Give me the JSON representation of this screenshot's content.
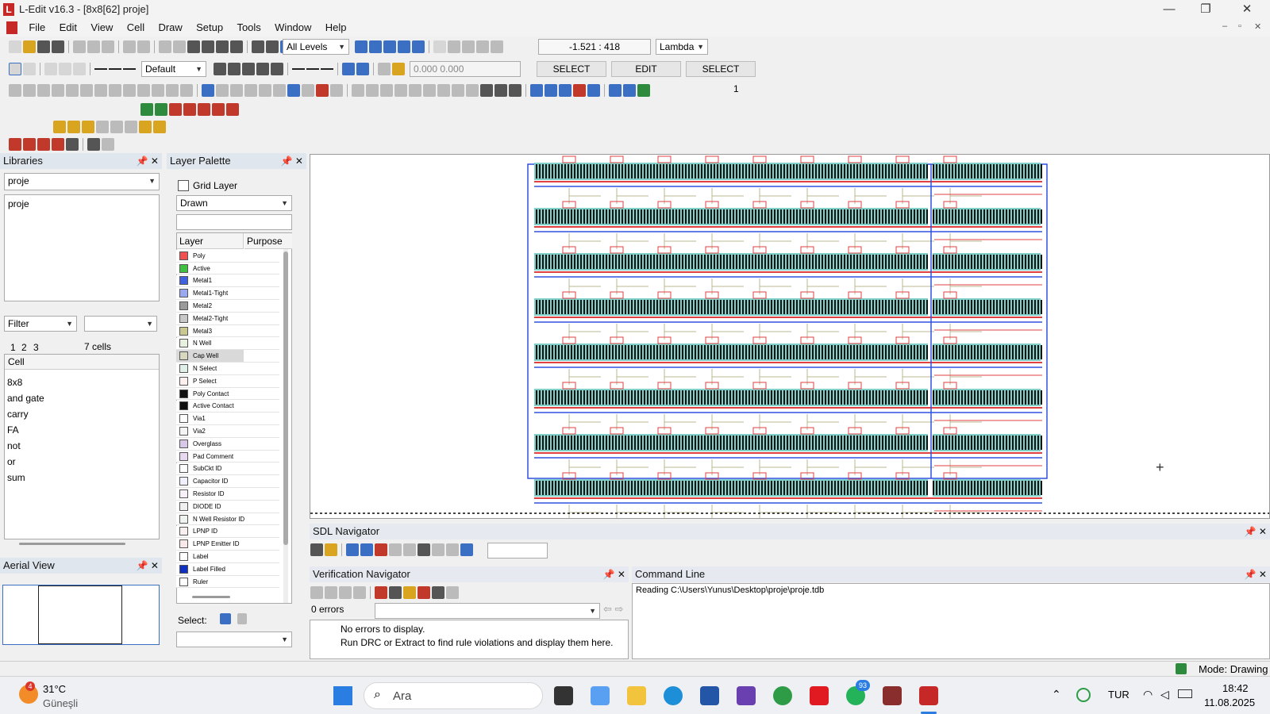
{
  "window": {
    "title": "L-Edit v16.3 - [8x8[62]    proje]",
    "logo": "L",
    "controls": [
      "—",
      "❐",
      "✕"
    ],
    "doc_controls": [
      "–",
      "▫",
      "✕"
    ]
  },
  "menu": [
    "File",
    "Edit",
    "View",
    "Cell",
    "Draw",
    "Setup",
    "Tools",
    "Window",
    "Help"
  ],
  "toolbar": {
    "view_level": "All Levels",
    "coords": "-1.521 : 418",
    "units": "Lambda",
    "style": "Default",
    "coord_input": "0.000 0.000",
    "mode_buttons": [
      "SELECT",
      "EDIT",
      "SELECT"
    ],
    "count_value": "1"
  },
  "libraries": {
    "title": "Libraries",
    "selected": "proje",
    "list": [
      "proje"
    ],
    "filter_label": "Filter",
    "tabs": [
      "1",
      "2",
      "3"
    ],
    "count": "7 cells",
    "cell_header": "Cell",
    "cells": [
      "8x8",
      "and gate",
      "carry",
      "FA",
      "not",
      "or",
      "sum"
    ]
  },
  "layer_palette": {
    "title": "Layer Palette",
    "grid_layer": "Grid Layer",
    "view_mode": "Drawn",
    "col_layer": "Layer",
    "col_purpose": "Purpose",
    "select_label": "Select:",
    "layers": [
      {
        "name": "Poly",
        "color": "#f05050"
      },
      {
        "name": "Active",
        "color": "#40c040"
      },
      {
        "name": "Metal1",
        "color": "#4060e0"
      },
      {
        "name": "Metal1-Tight",
        "color": "#9aa8f0"
      },
      {
        "name": "Metal2",
        "color": "#9a9a9a"
      },
      {
        "name": "Metal2-Tight",
        "color": "#c8c8c8"
      },
      {
        "name": "Metal3",
        "color": "#c8c890"
      },
      {
        "name": "N Well",
        "color": "#e8f0e0"
      },
      {
        "name": "Cap Well",
        "color": "#d8d8c0"
      },
      {
        "name": "N Select",
        "color": "#e0f0e8"
      },
      {
        "name": "P Select",
        "color": "#fff0f0"
      },
      {
        "name": "Poly Contact",
        "color": "#111111"
      },
      {
        "name": "Active Contact",
        "color": "#111111"
      },
      {
        "name": "Via1",
        "color": "#ffffff"
      },
      {
        "name": "Via2",
        "color": "#f4f4f4"
      },
      {
        "name": "Overglass",
        "color": "#d8c8e8"
      },
      {
        "name": "Pad Comment",
        "color": "#e8d8f0"
      },
      {
        "name": "SubCkt ID",
        "color": "#ffffff"
      },
      {
        "name": "Capacitor ID",
        "color": "#f0f0ff"
      },
      {
        "name": "Resistor ID",
        "color": "#f8f0f8"
      },
      {
        "name": "DIODE ID",
        "color": "#f0f0f0"
      },
      {
        "name": "N Well Resistor ID",
        "color": "#f0f4f0"
      },
      {
        "name": "LPNP ID",
        "color": "#f8f0f0"
      },
      {
        "name": "LPNP Emitter ID",
        "color": "#f8e8e8"
      },
      {
        "name": "Label",
        "color": "#ffffff"
      },
      {
        "name": "Label Filled",
        "color": "#1030c0"
      },
      {
        "name": "Ruler",
        "color": "#ffffff"
      }
    ]
  },
  "aerial": {
    "title": "Aerial View"
  },
  "sdl": {
    "title": "SDL Navigator"
  },
  "verification": {
    "title": "Verification Navigator",
    "errors": "0 errors",
    "msg1": "No errors to display.",
    "msg2": "Run DRC or Extract to find rule violations and display them here."
  },
  "command_line": {
    "title": "Command Line",
    "text": "Reading C:\\Users\\Yunus\\Desktop\\proje\\proje.tdb"
  },
  "status": {
    "mode": "Mode: Drawing"
  },
  "taskbar": {
    "weather_badge": "4",
    "temp": "31°C",
    "condition": "Güneşli",
    "search": "Ara",
    "badge_count": "93",
    "lang": "TUR",
    "time": "18:42",
    "date": "11.08.2025"
  }
}
